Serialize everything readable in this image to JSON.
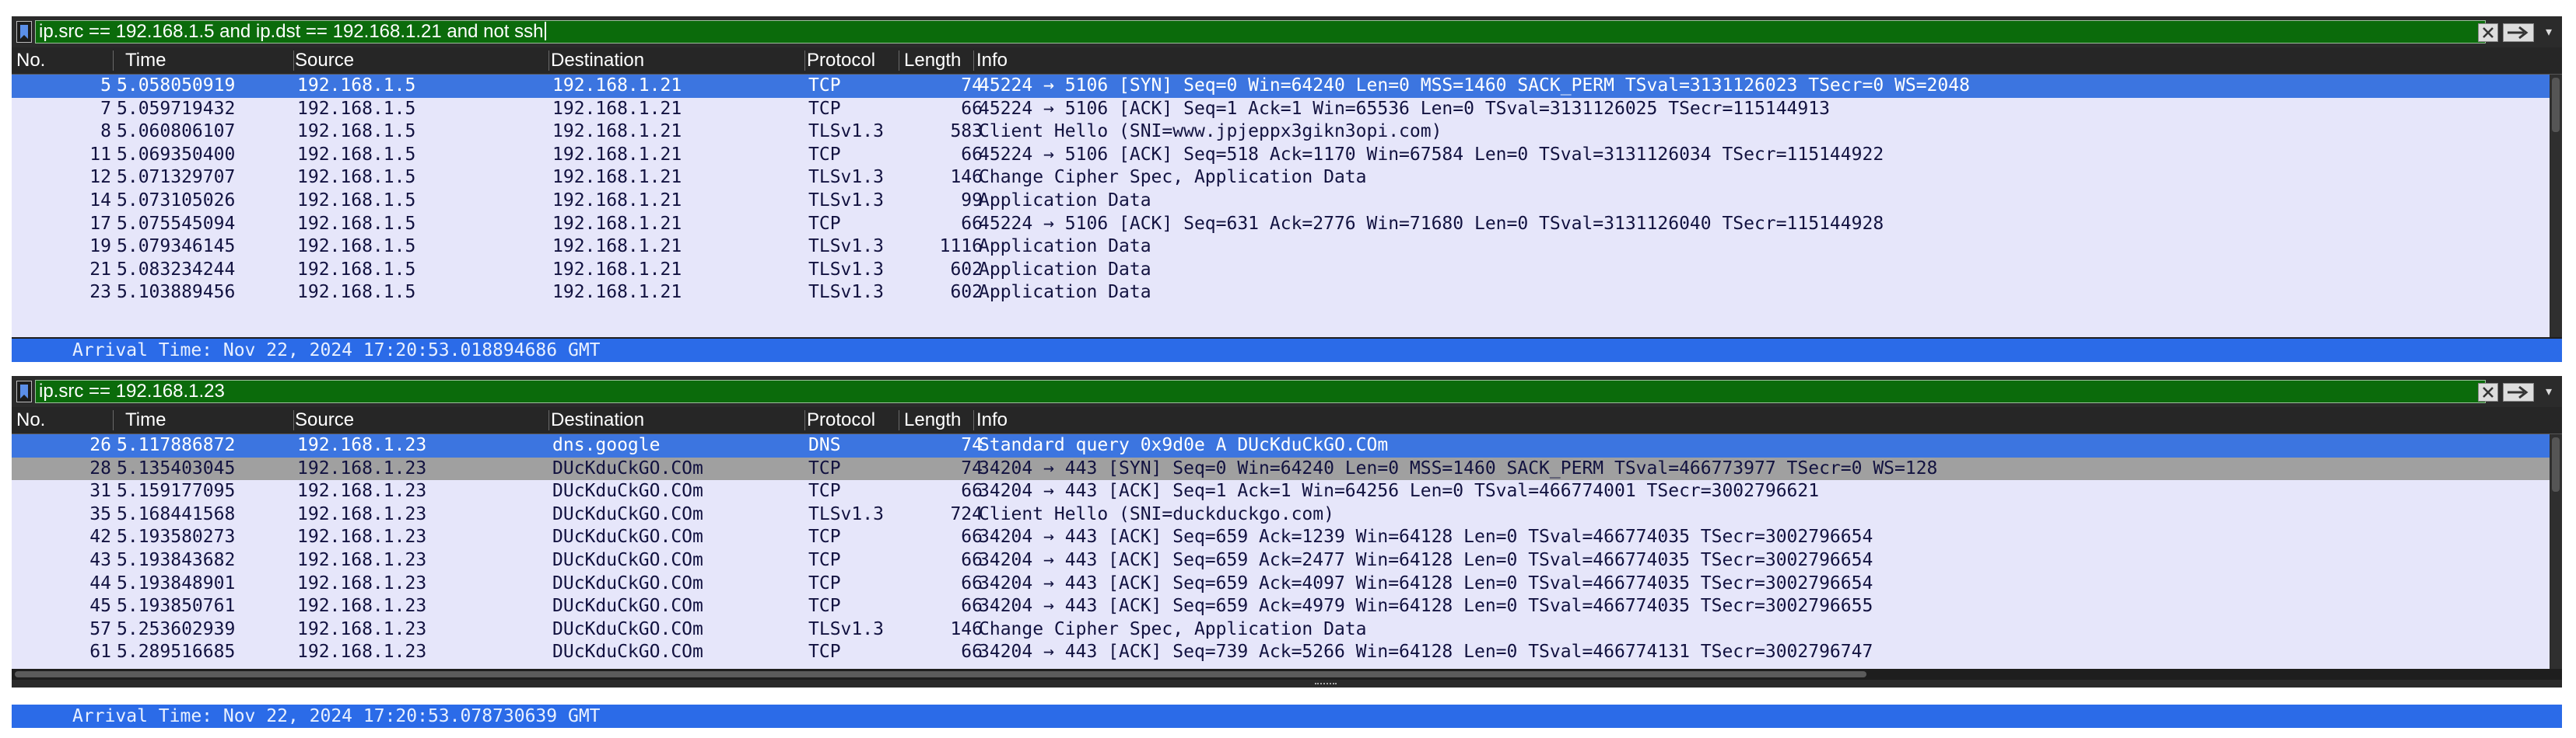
{
  "columns": {
    "no": "No.",
    "time": "Time",
    "source": "Source",
    "destination": "Destination",
    "protocol": "Protocol",
    "length": "Length",
    "info": "Info"
  },
  "pane1": {
    "filter": "ip.src == 192.168.1.5 and ip.dst == 192.168.1.21 and not ssh",
    "status": "Arrival Time: Nov 22, 2024 17:20:53.018894686 GMT",
    "rows": [
      {
        "no": "5",
        "time": "5.058050919",
        "src": "192.168.1.5",
        "dst": "192.168.1.21",
        "proto": "TCP",
        "len": "74",
        "info": "45224 → 5106 [SYN] Seq=0 Win=64240 Len=0 MSS=1460 SACK_PERM TSval=3131126023 TSecr=0 WS=2048",
        "style": "sel"
      },
      {
        "no": "7",
        "time": "5.059719432",
        "src": "192.168.1.5",
        "dst": "192.168.1.21",
        "proto": "TCP",
        "len": "66",
        "info": "45224 → 5106 [ACK] Seq=1 Ack=1 Win=65536 Len=0 TSval=3131126025 TSecr=115144913",
        "style": ""
      },
      {
        "no": "8",
        "time": "5.060806107",
        "src": "192.168.1.5",
        "dst": "192.168.1.21",
        "proto": "TLSv1.3",
        "len": "583",
        "info": "Client Hello (SNI=www.jpjeppx3gikn3opi.com)",
        "style": ""
      },
      {
        "no": "11",
        "time": "5.069350400",
        "src": "192.168.1.5",
        "dst": "192.168.1.21",
        "proto": "TCP",
        "len": "66",
        "info": "45224 → 5106 [ACK] Seq=518 Ack=1170 Win=67584 Len=0 TSval=3131126034 TSecr=115144922",
        "style": ""
      },
      {
        "no": "12",
        "time": "5.071329707",
        "src": "192.168.1.5",
        "dst": "192.168.1.21",
        "proto": "TLSv1.3",
        "len": "146",
        "info": "Change Cipher Spec, Application Data",
        "style": ""
      },
      {
        "no": "14",
        "time": "5.073105026",
        "src": "192.168.1.5",
        "dst": "192.168.1.21",
        "proto": "TLSv1.3",
        "len": "99",
        "info": "Application Data",
        "style": ""
      },
      {
        "no": "17",
        "time": "5.075545094",
        "src": "192.168.1.5",
        "dst": "192.168.1.21",
        "proto": "TCP",
        "len": "66",
        "info": "45224 → 5106 [ACK] Seq=631 Ack=2776 Win=71680 Len=0 TSval=3131126040 TSecr=115144928",
        "style": ""
      },
      {
        "no": "19",
        "time": "5.079346145",
        "src": "192.168.1.5",
        "dst": "192.168.1.21",
        "proto": "TLSv1.3",
        "len": "1116",
        "info": "Application Data",
        "style": ""
      },
      {
        "no": "21",
        "time": "5.083234244",
        "src": "192.168.1.5",
        "dst": "192.168.1.21",
        "proto": "TLSv1.3",
        "len": "602",
        "info": "Application Data",
        "style": ""
      },
      {
        "no": "23",
        "time": "5.103889456",
        "src": "192.168.1.5",
        "dst": "192.168.1.21",
        "proto": "TLSv1.3",
        "len": "602",
        "info": "Application Data",
        "style": ""
      }
    ]
  },
  "pane2": {
    "filter": "ip.src == 192.168.1.23",
    "status": "Arrival Time: Nov 22, 2024 17:20:53.078730639 GMT",
    "rows": [
      {
        "no": "26",
        "time": "5.117886872",
        "src": "192.168.1.23",
        "dst": "dns.google",
        "proto": "DNS",
        "len": "74",
        "info": "Standard query 0x9d0e A DUcKduCkGO.COm",
        "style": "sel"
      },
      {
        "no": "28",
        "time": "5.135403045",
        "src": "192.168.1.23",
        "dst": "DUcKduCkGO.COm",
        "proto": "TCP",
        "len": "74",
        "info": "34204 → 443 [SYN] Seq=0 Win=64240 Len=0 MSS=1460 SACK_PERM TSval=466773977 TSecr=0 WS=128",
        "style": "gray"
      },
      {
        "no": "31",
        "time": "5.159177095",
        "src": "192.168.1.23",
        "dst": "DUcKduCkGO.COm",
        "proto": "TCP",
        "len": "66",
        "info": "34204 → 443 [ACK] Seq=1 Ack=1 Win=64256 Len=0 TSval=466774001 TSecr=3002796621",
        "style": ""
      },
      {
        "no": "35",
        "time": "5.168441568",
        "src": "192.168.1.23",
        "dst": "DUcKduCkGO.COm",
        "proto": "TLSv1.3",
        "len": "724",
        "info": "Client Hello (SNI=duckduckgo.com)",
        "style": ""
      },
      {
        "no": "42",
        "time": "5.193580273",
        "src": "192.168.1.23",
        "dst": "DUcKduCkGO.COm",
        "proto": "TCP",
        "len": "66",
        "info": "34204 → 443 [ACK] Seq=659 Ack=1239 Win=64128 Len=0 TSval=466774035 TSecr=3002796654",
        "style": ""
      },
      {
        "no": "43",
        "time": "5.193843682",
        "src": "192.168.1.23",
        "dst": "DUcKduCkGO.COm",
        "proto": "TCP",
        "len": "66",
        "info": "34204 → 443 [ACK] Seq=659 Ack=2477 Win=64128 Len=0 TSval=466774035 TSecr=3002796654",
        "style": ""
      },
      {
        "no": "44",
        "time": "5.193848901",
        "src": "192.168.1.23",
        "dst": "DUcKduCkGO.COm",
        "proto": "TCP",
        "len": "66",
        "info": "34204 → 443 [ACK] Seq=659 Ack=4097 Win=64128 Len=0 TSval=466774035 TSecr=3002796654",
        "style": ""
      },
      {
        "no": "45",
        "time": "5.193850761",
        "src": "192.168.1.23",
        "dst": "DUcKduCkGO.COm",
        "proto": "TCP",
        "len": "66",
        "info": "34204 → 443 [ACK] Seq=659 Ack=4979 Win=64128 Len=0 TSval=466774035 TSecr=3002796655",
        "style": ""
      },
      {
        "no": "57",
        "time": "5.253602939",
        "src": "192.168.1.23",
        "dst": "DUcKduCkGO.COm",
        "proto": "TLSv1.3",
        "len": "146",
        "info": "Change Cipher Spec, Application Data",
        "style": ""
      },
      {
        "no": "61",
        "time": "5.289516685",
        "src": "192.168.1.23",
        "dst": "DUcKduCkGO.COm",
        "proto": "TCP",
        "len": "66",
        "info": "34204 → 443 [ACK] Seq=739 Ack=5266 Win=64128 Len=0 TSval=466774131 TSecr=3002796747",
        "style": ""
      }
    ]
  }
}
